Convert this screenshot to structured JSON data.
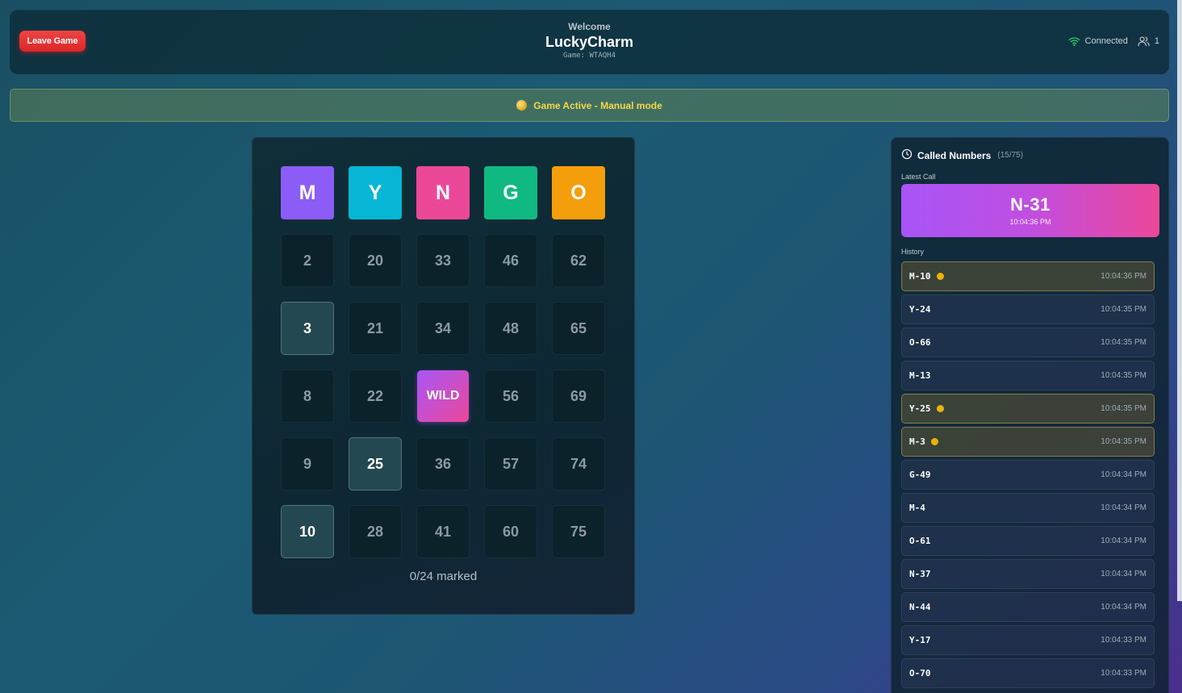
{
  "header": {
    "leave_label": "Leave Game",
    "welcome": "Welcome",
    "username": "LuckyCharm",
    "game_code": "Game: WTAQH4",
    "connection": "Connected",
    "players": "1",
    "accent_connected": "#22c55e"
  },
  "status": {
    "text": "Game Active - Manual mode",
    "color": "#f5d84a"
  },
  "card": {
    "headers": [
      {
        "letter": "M",
        "color": "#8b5cf6"
      },
      {
        "letter": "Y",
        "color": "#06b6d4"
      },
      {
        "letter": "N",
        "color": "#ec4899"
      },
      {
        "letter": "G",
        "color": "#10b981"
      },
      {
        "letter": "O",
        "color": "#f59e0b"
      }
    ],
    "rows": [
      [
        {
          "v": "2"
        },
        {
          "v": "20"
        },
        {
          "v": "33"
        },
        {
          "v": "46"
        },
        {
          "v": "62"
        }
      ],
      [
        {
          "v": "3",
          "called": true
        },
        {
          "v": "21"
        },
        {
          "v": "34"
        },
        {
          "v": "48"
        },
        {
          "v": "65"
        }
      ],
      [
        {
          "v": "8"
        },
        {
          "v": "22"
        },
        {
          "v": "WILD",
          "wild": true
        },
        {
          "v": "56"
        },
        {
          "v": "69"
        }
      ],
      [
        {
          "v": "9"
        },
        {
          "v": "25",
          "called": true
        },
        {
          "v": "36"
        },
        {
          "v": "57"
        },
        {
          "v": "74"
        }
      ],
      [
        {
          "v": "10",
          "called": true
        },
        {
          "v": "28"
        },
        {
          "v": "41"
        },
        {
          "v": "60"
        },
        {
          "v": "75"
        }
      ]
    ],
    "marked_text": "0/24 marked"
  },
  "called": {
    "title": "Called Numbers",
    "count": "(15/75)",
    "latest_label": "Latest Call",
    "latest_number": "N-31",
    "latest_time": "10:04:36 PM",
    "history_label": "History",
    "history": [
      {
        "num": "M-10",
        "time": "10:04:36 PM",
        "hit": true
      },
      {
        "num": "Y-24",
        "time": "10:04:35 PM",
        "hit": false
      },
      {
        "num": "O-66",
        "time": "10:04:35 PM",
        "hit": false
      },
      {
        "num": "M-13",
        "time": "10:04:35 PM",
        "hit": false
      },
      {
        "num": "Y-25",
        "time": "10:04:35 PM",
        "hit": true
      },
      {
        "num": "M-3",
        "time": "10:04:35 PM",
        "hit": true
      },
      {
        "num": "G-49",
        "time": "10:04:34 PM",
        "hit": false
      },
      {
        "num": "M-4",
        "time": "10:04:34 PM",
        "hit": false
      },
      {
        "num": "O-61",
        "time": "10:04:34 PM",
        "hit": false
      },
      {
        "num": "N-37",
        "time": "10:04:34 PM",
        "hit": false
      },
      {
        "num": "N-44",
        "time": "10:04:34 PM",
        "hit": false
      },
      {
        "num": "Y-17",
        "time": "10:04:33 PM",
        "hit": false
      },
      {
        "num": "O-70",
        "time": "10:04:33 PM",
        "hit": false
      }
    ]
  }
}
